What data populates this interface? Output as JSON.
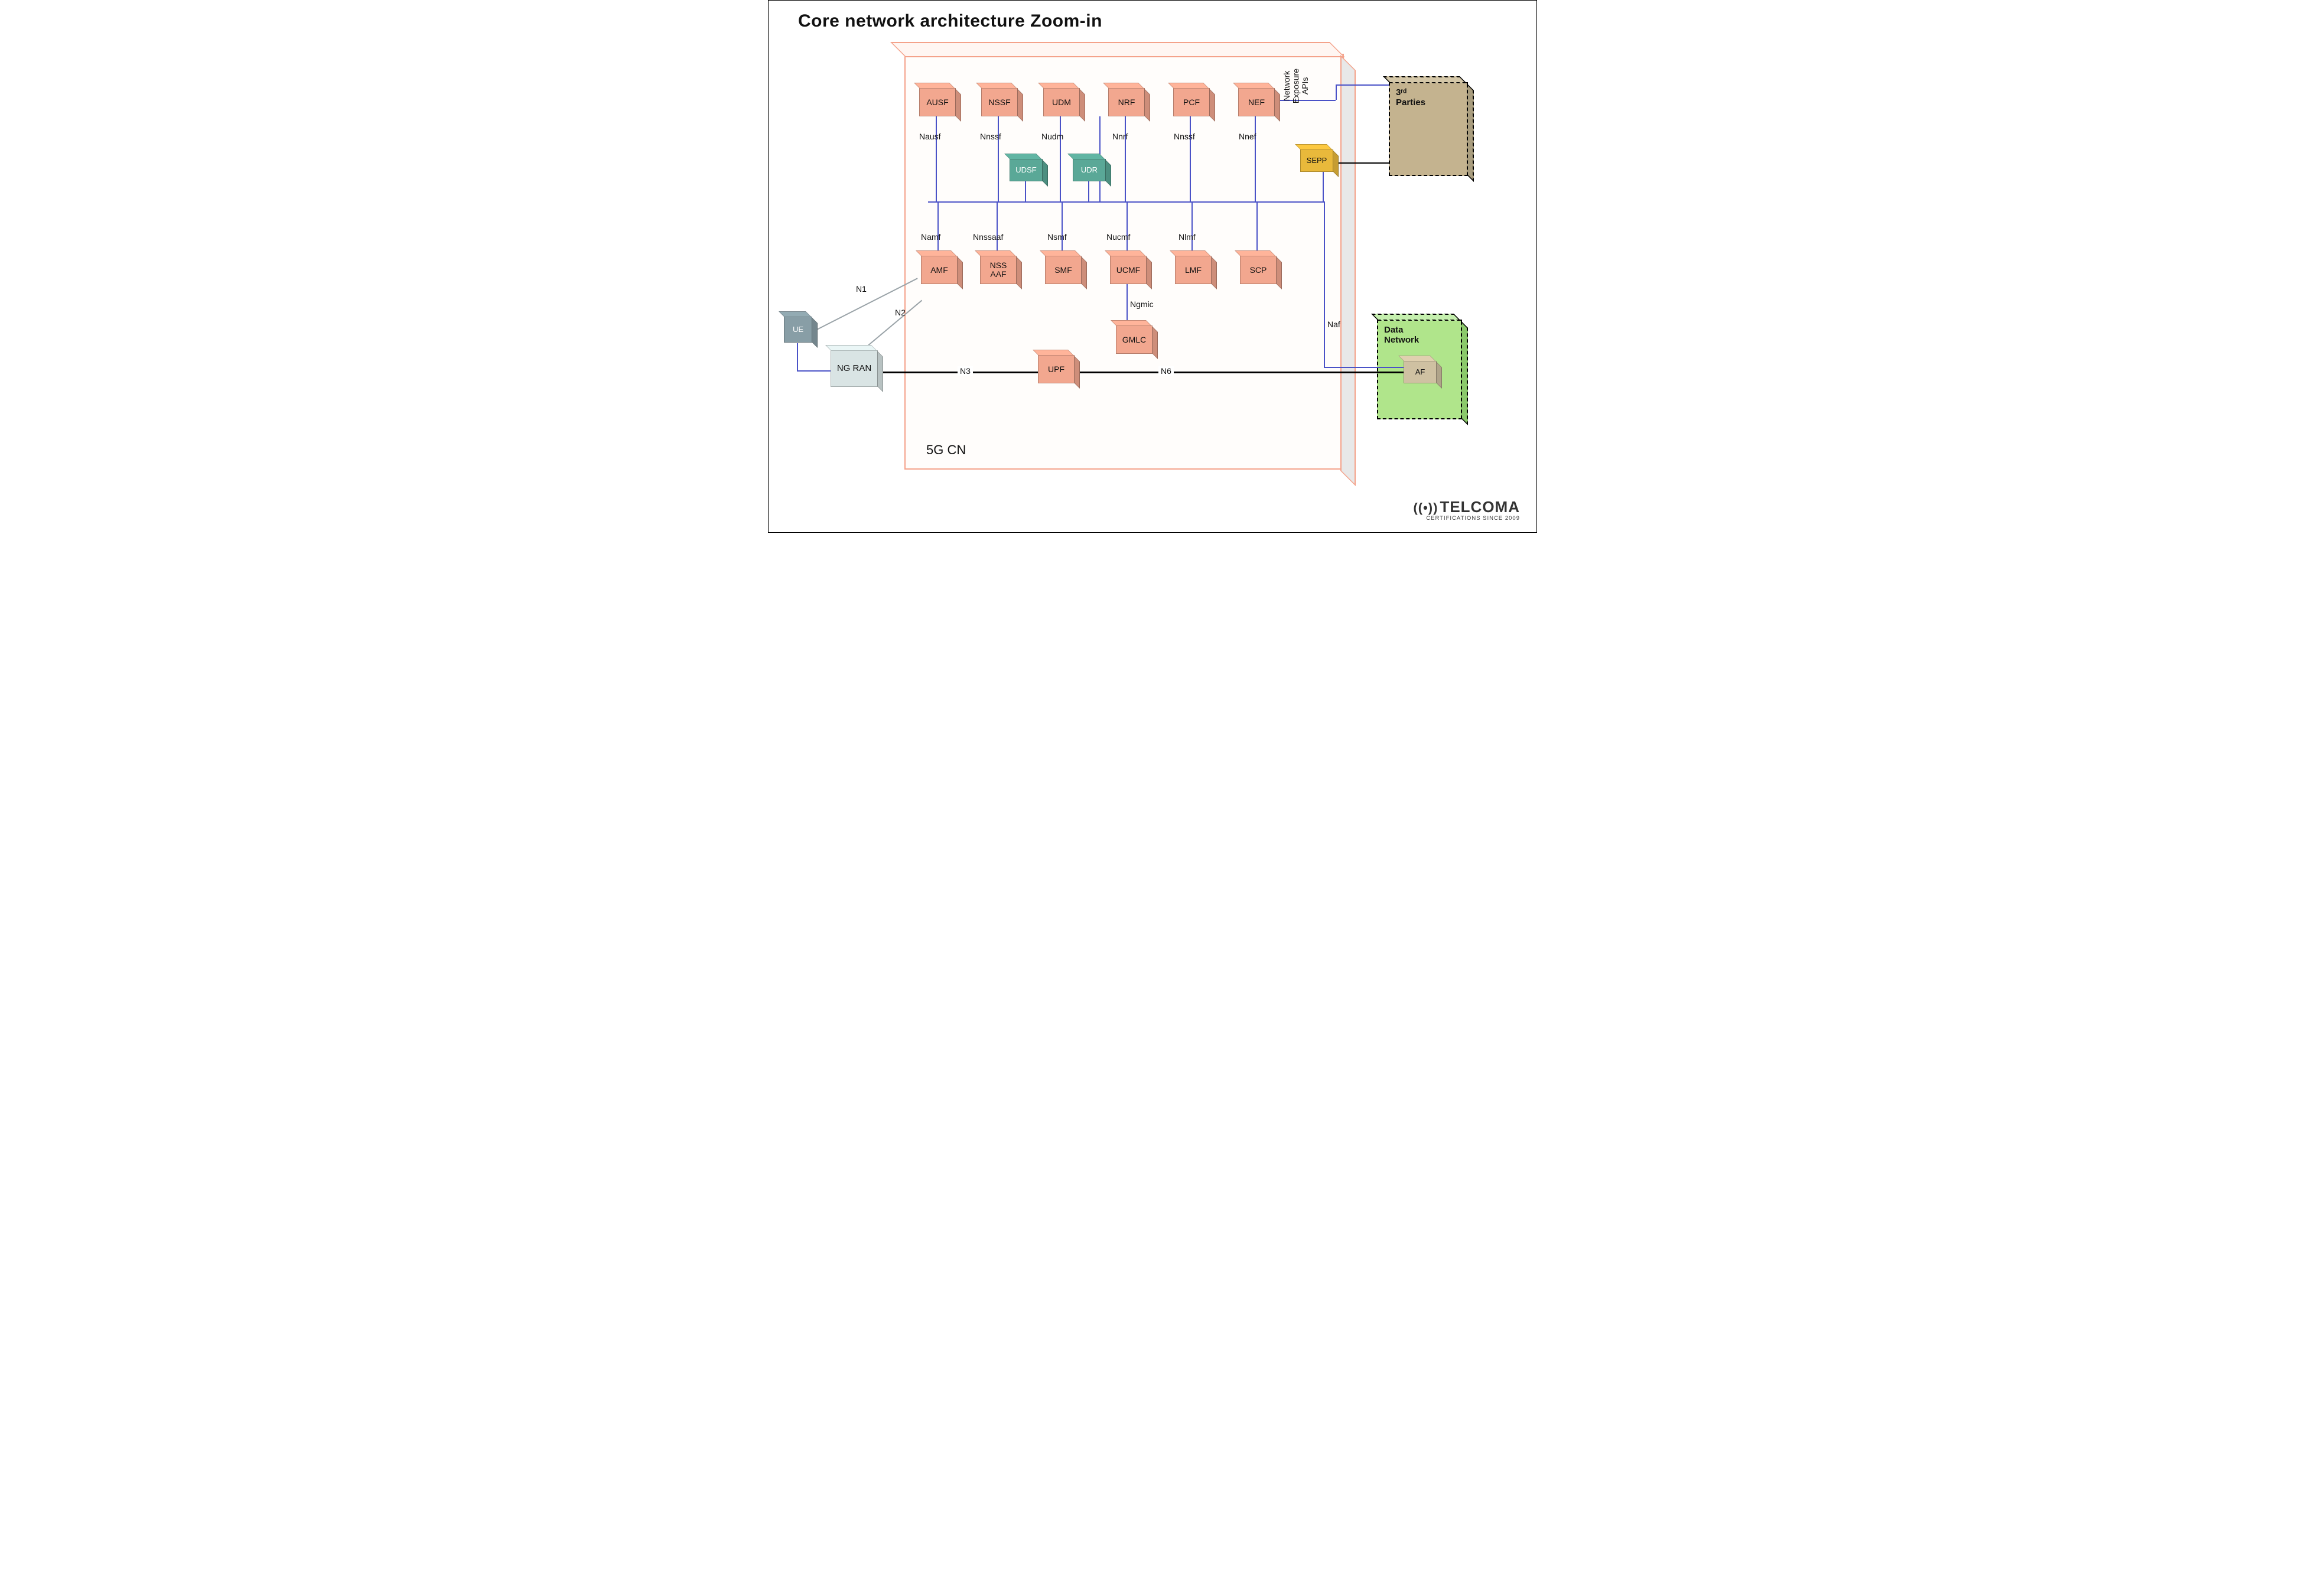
{
  "title": "Core network architecture Zoom-in",
  "container_label": "5G CN",
  "top_row": {
    "ausf": {
      "label": "AUSF",
      "iface": "Nausf"
    },
    "nssf": {
      "label": "NSSF",
      "iface": "Nnssf"
    },
    "udm": {
      "label": "UDM",
      "iface": "Nudm"
    },
    "nrf": {
      "label": "NRF",
      "iface": "Nnrf"
    },
    "pcf": {
      "label": "PCF",
      "iface": "Nnssf"
    },
    "nef": {
      "label": "NEF",
      "iface": "Nnef"
    }
  },
  "storage": {
    "udsf": {
      "label": "UDSF"
    },
    "udr": {
      "label": "UDR"
    }
  },
  "mid_row": {
    "amf": {
      "label": "AMF",
      "iface": "Namf"
    },
    "nssaaf": {
      "label": "NSS\nAAF",
      "iface": "Nnssaaf"
    },
    "smf": {
      "label": "SMF",
      "iface": "Nsmf"
    },
    "ucmf": {
      "label": "UCMF",
      "iface": "Nucmf"
    },
    "lmf": {
      "label": "LMF",
      "iface": "Nlmf"
    },
    "scp": {
      "label": "SCP"
    }
  },
  "lower": {
    "gmlc": {
      "label": "GMLC",
      "iface": "Ngmic"
    },
    "upf": {
      "label": "UPF"
    }
  },
  "edge": {
    "sepp": {
      "label": "SEPP"
    },
    "af_iface": "Naf",
    "nef_expose": "Network\nExposure\nAPIs"
  },
  "left": {
    "ue": {
      "label": "UE"
    },
    "ngran": {
      "label": "NG RAN"
    },
    "n1": "N1",
    "n2": "N2"
  },
  "conn": {
    "n3": "N3",
    "n6": "N6"
  },
  "ext": {
    "parties": {
      "title": "3ʳᵈ\nParties"
    },
    "dn": {
      "title": "Data\nNetwork"
    },
    "af": {
      "label": "AF"
    }
  },
  "logo": {
    "brand": "TELCOMA",
    "tag": "CERTIFICATIONS SINCE 2009"
  }
}
